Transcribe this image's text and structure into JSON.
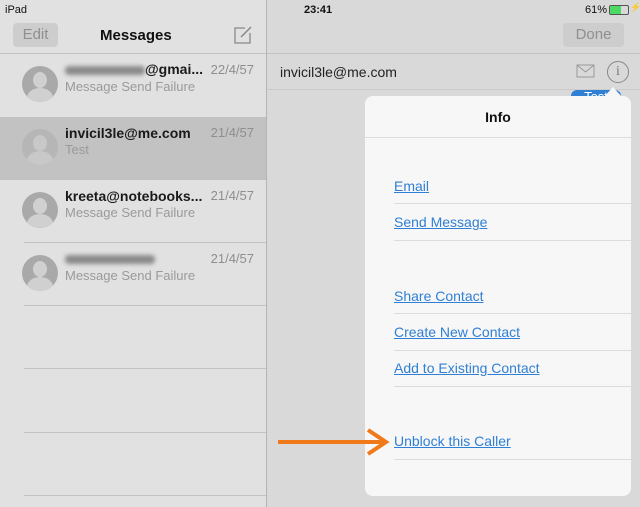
{
  "status_bar": {
    "device": "iPad",
    "time": "23:41",
    "battery": "61%",
    "battery_level": 0.61,
    "battery_color": "#4cd964"
  },
  "sidebar": {
    "edit_label": "Edit",
    "title": "Messages",
    "compose_icon": "compose-icon",
    "conversations": [
      {
        "name_visible": "@gmai...",
        "name_blurred": true,
        "date": "22/4/57",
        "preview": "Message Send Failure",
        "selected": false
      },
      {
        "name_visible": "invicil3le@me.com",
        "name_blurred": false,
        "date": "21/4/57",
        "preview": "Test",
        "selected": true
      },
      {
        "name_visible": "kreeta@notebooks...",
        "name_blurred": false,
        "date": "21/4/57",
        "preview": "Message Send Failure",
        "selected": false
      },
      {
        "name_visible": "",
        "name_blurred": true,
        "date": "21/4/57",
        "preview": "Message Send Failure",
        "selected": false
      }
    ]
  },
  "detail": {
    "done_label": "Done",
    "recipient": "invicil3le@me.com",
    "bubble_text": "Test",
    "accent": "#2f7fd4"
  },
  "info_popover": {
    "title": "Info",
    "items": [
      "Email",
      "Send Message",
      "Share Contact",
      "Create New Contact",
      "Add to Existing Contact",
      "Unblock this Caller"
    ]
  },
  "annotation": {
    "arrow_color": "#f07a1a"
  }
}
